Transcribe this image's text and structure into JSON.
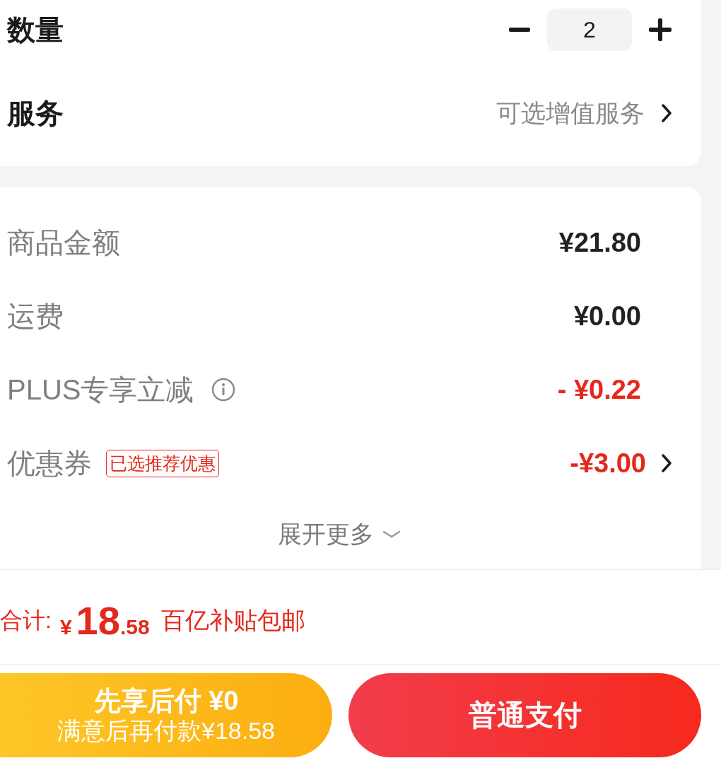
{
  "options_card": {
    "quantity": {
      "label": "数量",
      "value": "2"
    },
    "service": {
      "label": "服务",
      "value": "可选增值服务"
    }
  },
  "price_card": {
    "rows": [
      {
        "kind": "charge",
        "label": "商品金额",
        "amount": "¥21.80"
      },
      {
        "kind": "charge",
        "label": "运费",
        "amount": "¥0.00"
      },
      {
        "kind": "member_discount",
        "label": "PLUS专享立减",
        "amount": "- ¥0.22"
      },
      {
        "kind": "coupon",
        "label": "优惠券",
        "tag": "已选推荐优惠",
        "amount": "-¥3.00"
      }
    ],
    "expand": {
      "label": "展开更多",
      "expanded": false
    }
  },
  "summary": {
    "label": "合计:",
    "currency": "¥",
    "integer": "18",
    "decimals": ".58",
    "note": "百亿补贴包邮"
  },
  "actions": [
    {
      "kind": "pay_later",
      "title": "先享后付 ¥0",
      "subtitle": "满意后再付款¥18.58"
    },
    {
      "kind": "pay",
      "title": "普通支付"
    }
  ]
}
